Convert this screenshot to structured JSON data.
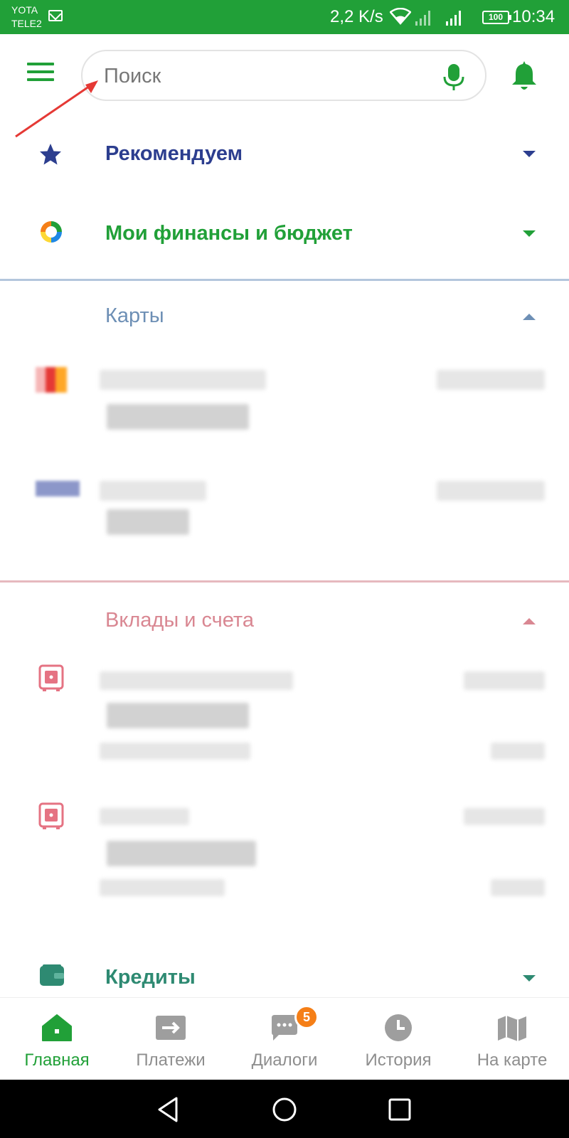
{
  "status_bar": {
    "carrier_1": "YOTA",
    "carrier_2": "TELE2",
    "speed": "2,2 K/s",
    "battery": "100",
    "time": "10:34"
  },
  "search": {
    "placeholder": "Поиск"
  },
  "sections": {
    "recommend": {
      "title": "Рекомендуем",
      "color": "#2c3e8f",
      "icon": "star-icon"
    },
    "finance": {
      "title": "Мои финансы и бюджет",
      "color": "#21a038",
      "icon": "budget-chart-icon"
    },
    "cards": {
      "title": "Карты",
      "color": "#6d8fb5",
      "icon": ""
    },
    "deposits": {
      "title": "Вклады и счета",
      "color": "#d98792",
      "icon": "safe-icon"
    },
    "credits": {
      "title": "Кредиты",
      "color": "#2e8a72",
      "icon": "wallet-icon"
    }
  },
  "bottom_nav": {
    "items": [
      {
        "label": "Главная",
        "icon": "home-icon",
        "active": true
      },
      {
        "label": "Платежи",
        "icon": "transfer-icon",
        "active": false
      },
      {
        "label": "Диалоги",
        "icon": "chat-icon",
        "active": false
      },
      {
        "label": "История",
        "icon": "clock-icon",
        "active": false
      },
      {
        "label": "На карте",
        "icon": "map-icon",
        "active": false
      }
    ],
    "dialogs_badge": "5"
  },
  "colors": {
    "brand_green": "#21a038",
    "badge_orange": "#f57f17"
  }
}
